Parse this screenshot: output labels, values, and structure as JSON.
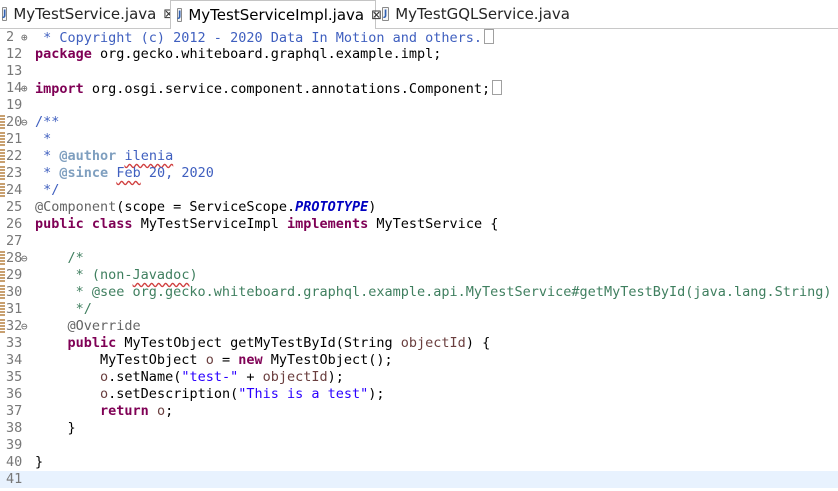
{
  "tabs": [
    {
      "label": "MyTestService.java",
      "close": "⊠"
    },
    {
      "label": "MyTestServiceImpl.java",
      "close": "⊠"
    },
    {
      "label": "MyTestGQLService.java"
    }
  ],
  "lines": [
    {
      "n": "2",
      "fold": "⊕",
      "parts": [
        {
          "c": "jd",
          "t": " * Copyright (c) 2012 - 2020 Data In Motion and others."
        }
      ],
      "box": true
    },
    {
      "n": "12",
      "parts": [
        {
          "c": "kw",
          "t": "package"
        },
        {
          "c": "",
          "t": " org.gecko.whiteboard.graphql.example.impl;"
        }
      ]
    },
    {
      "n": "13",
      "parts": []
    },
    {
      "n": "14",
      "fold": "⊕",
      "parts": [
        {
          "c": "kw",
          "t": "import"
        },
        {
          "c": "",
          "t": " org.osgi.service.component.annotations.Component;"
        }
      ],
      "box": true
    },
    {
      "n": "19",
      "parts": []
    },
    {
      "n": "20",
      "fold": "⊖",
      "mark": true,
      "parts": [
        {
          "c": "jd",
          "t": "/**"
        }
      ]
    },
    {
      "n": "21",
      "mark": true,
      "parts": [
        {
          "c": "jd",
          "t": " *"
        }
      ]
    },
    {
      "n": "22",
      "mark": true,
      "parts": [
        {
          "c": "jd",
          "t": " * "
        },
        {
          "c": "tag",
          "t": "@author"
        },
        {
          "c": "jd",
          "t": " "
        },
        {
          "c": "jd sq",
          "t": "ilenia"
        }
      ]
    },
    {
      "n": "23",
      "mark": true,
      "parts": [
        {
          "c": "jd",
          "t": " * "
        },
        {
          "c": "tag",
          "t": "@since"
        },
        {
          "c": "jd",
          "t": " "
        },
        {
          "c": "jd sq",
          "t": "Feb"
        },
        {
          "c": "jd",
          "t": " 20, 2020"
        }
      ]
    },
    {
      "n": "24",
      "mark": true,
      "parts": [
        {
          "c": "jd",
          "t": " */"
        }
      ]
    },
    {
      "n": "25",
      "parts": [
        {
          "c": "ann",
          "t": "@Component"
        },
        {
          "c": "",
          "t": "(scope = ServiceScope."
        },
        {
          "c": "ital",
          "t": "PROTOTYPE"
        },
        {
          "c": "",
          "t": ")"
        }
      ]
    },
    {
      "n": "26",
      "parts": [
        {
          "c": "kw",
          "t": "public"
        },
        {
          "c": "",
          "t": " "
        },
        {
          "c": "kw",
          "t": "class"
        },
        {
          "c": "",
          "t": " MyTestServiceImpl "
        },
        {
          "c": "kw",
          "t": "implements"
        },
        {
          "c": "",
          "t": " MyTestService {"
        }
      ]
    },
    {
      "n": "27",
      "parts": []
    },
    {
      "n": "28",
      "fold": "⊖",
      "mark": true,
      "parts": [
        {
          "c": "cm",
          "t": "    /*"
        }
      ]
    },
    {
      "n": "29",
      "mark": true,
      "parts": [
        {
          "c": "cm",
          "t": "     * (non-"
        },
        {
          "c": "cm sq",
          "t": "Javadoc"
        },
        {
          "c": "cm",
          "t": ")"
        }
      ]
    },
    {
      "n": "30",
      "mark": true,
      "parts": [
        {
          "c": "cm",
          "t": "     * @see org.gecko.whiteboard.graphql.example.api.MyTestService#getMyTestById(java.lang.String)"
        }
      ]
    },
    {
      "n": "31",
      "mark": true,
      "parts": [
        {
          "c": "cm",
          "t": "     */"
        }
      ]
    },
    {
      "n": "32",
      "fold": "⊖",
      "mark": true,
      "parts": [
        {
          "c": "ann",
          "t": "    @Override"
        }
      ]
    },
    {
      "n": "33",
      "arrow": true,
      "parts": [
        {
          "c": "",
          "t": "    "
        },
        {
          "c": "kw",
          "t": "public"
        },
        {
          "c": "",
          "t": " MyTestObject getMyTestById(String "
        },
        {
          "c": "var",
          "t": "objectId"
        },
        {
          "c": "",
          "t": ") {"
        }
      ]
    },
    {
      "n": "34",
      "parts": [
        {
          "c": "",
          "t": "        MyTestObject "
        },
        {
          "c": "var",
          "t": "o"
        },
        {
          "c": "",
          "t": " = "
        },
        {
          "c": "kw",
          "t": "new"
        },
        {
          "c": "",
          "t": " MyTestObject();"
        }
      ]
    },
    {
      "n": "35",
      "parts": [
        {
          "c": "",
          "t": "        "
        },
        {
          "c": "var",
          "t": "o"
        },
        {
          "c": "",
          "t": ".setName("
        },
        {
          "c": "str",
          "t": "\"test-\""
        },
        {
          "c": "",
          "t": " + "
        },
        {
          "c": "var",
          "t": "objectId"
        },
        {
          "c": "",
          "t": ");"
        }
      ]
    },
    {
      "n": "36",
      "parts": [
        {
          "c": "",
          "t": "        "
        },
        {
          "c": "var",
          "t": "o"
        },
        {
          "c": "",
          "t": ".setDescription("
        },
        {
          "c": "str",
          "t": "\"This is a test\""
        },
        {
          "c": "",
          "t": ");"
        }
      ]
    },
    {
      "n": "37",
      "parts": [
        {
          "c": "",
          "t": "        "
        },
        {
          "c": "kw",
          "t": "return"
        },
        {
          "c": "",
          "t": " "
        },
        {
          "c": "var",
          "t": "o"
        },
        {
          "c": "",
          "t": ";"
        }
      ]
    },
    {
      "n": "38",
      "parts": [
        {
          "c": "",
          "t": "    }"
        }
      ]
    },
    {
      "n": "39",
      "parts": []
    },
    {
      "n": "40",
      "parts": [
        {
          "c": "",
          "t": "}"
        }
      ]
    },
    {
      "n": "41",
      "current": true,
      "parts": []
    }
  ],
  "colors": {
    "keyword": "#7f0055",
    "comment": "#3f7f5f",
    "javadoc": "#3f5fbf",
    "string": "#2a00ff",
    "annotation": "#646464",
    "current_line": "#e8f2fe"
  }
}
